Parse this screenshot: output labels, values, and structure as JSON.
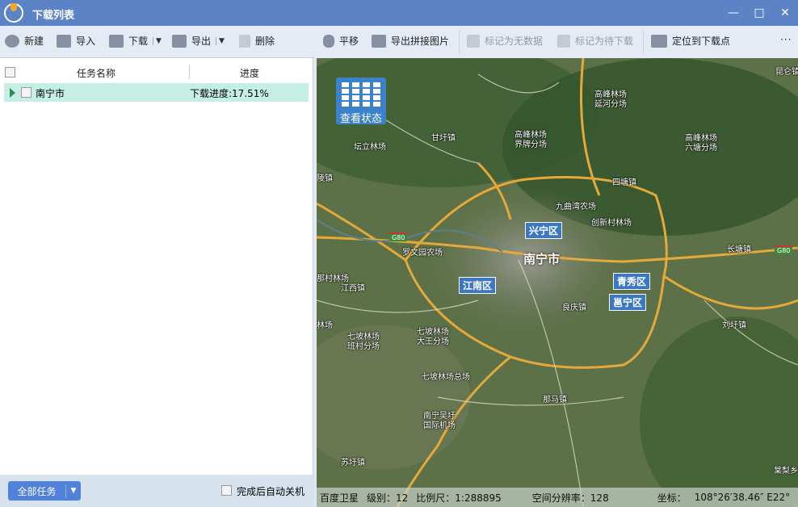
{
  "window": {
    "title": "下载列表",
    "minimize": "—",
    "maximize": "□",
    "close": "✕"
  },
  "left_toolbar": {
    "new": "新建",
    "import": "导入",
    "download": "下载",
    "export": "导出",
    "delete": "删除",
    "dropdown": "▼"
  },
  "task_list": {
    "columns": [
      "任务名称",
      "进度"
    ],
    "rows": [
      {
        "name": "南宁市",
        "progress": "下载进度:17.51%",
        "progress_value": 17.51
      }
    ]
  },
  "footer": {
    "all_tasks": "全部任务",
    "dropdown": "▼",
    "auto_shutdown": "完成后自动关机"
  },
  "map_toolbar": {
    "pan": "平移",
    "export_stitched": "导出拼接图片",
    "mark_no_data": "标记为无数据",
    "mark_pending": "标记为待下载",
    "locate": "定位到下载点",
    "more": "···"
  },
  "map": {
    "status_button": "查看状态",
    "city": "南宁市",
    "districts": [
      "兴宁区",
      "江南区",
      "青秀区",
      "邕宁区"
    ],
    "highway": "G80",
    "places": [
      "昆仑镇",
      "高峰林场\n延河分场",
      "甘圩镇",
      "高峰林场\n界牌分场",
      "高峰林场\n六塘分场",
      "坛立林场",
      "四塘镇",
      "九曲湾农场",
      "创新村林场",
      "罗文园农场",
      "长塘镇",
      "陵镇",
      "那村林场",
      "江西镇",
      "良庆镇",
      "刘圩镇",
      "林场",
      "七坡林场\n班村分场",
      "七坡林场\n大王分场",
      "七坡林场总场",
      "那马镇",
      "南宁吴圩\n国际机场",
      "苏圩镇",
      "棠梨乡"
    ]
  },
  "statusbar": {
    "source": "百度卫星",
    "level": "级别：12",
    "scale": "比例尺：1:288895",
    "resolution": "空间分辨率：128",
    "coord_label": "坐标：",
    "coord": "108°26′38.46″ E22°"
  },
  "colors": {
    "titlebar": "#5b83c6",
    "row_selected": "#c5efe4",
    "primary": "#5182d8",
    "district": "#3b78c4",
    "road": "#e5a93a"
  }
}
